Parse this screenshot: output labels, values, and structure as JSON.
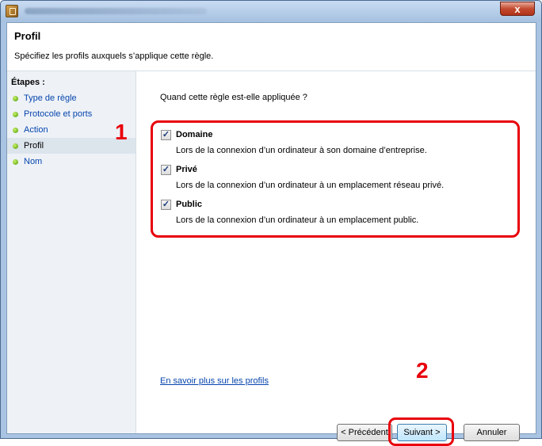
{
  "window": {
    "close_glyph": "x"
  },
  "header": {
    "title": "Profil",
    "description": "Spécifiez les profils auxquels s’applique cette règle."
  },
  "sidebar": {
    "title": "Étapes :",
    "items": [
      {
        "label": "Type de règle"
      },
      {
        "label": "Protocole et ports"
      },
      {
        "label": "Action"
      },
      {
        "label": "Profil"
      },
      {
        "label": "Nom"
      }
    ],
    "current_index": 3
  },
  "main": {
    "question": "Quand cette règle est-elle appliquée ?",
    "options": [
      {
        "title": "Domaine",
        "desc": "Lors de la connexion d’un ordinateur à son domaine d’entreprise.",
        "checked": true
      },
      {
        "title": "Privé",
        "desc": "Lors de la connexion d’un ordinateur à un emplacement réseau privé.",
        "checked": true
      },
      {
        "title": "Public",
        "desc": "Lors de la connexion d’un ordinateur à un emplacement public.",
        "checked": true
      }
    ],
    "learn_more": "En savoir plus sur les profils"
  },
  "buttons": {
    "back": "< Précédent",
    "next": "Suivant >",
    "cancel": "Annuler"
  },
  "annotations": {
    "one": "1",
    "two": "2"
  },
  "colors": {
    "highlight": "#e8000b",
    "link": "#0645ad",
    "step_dot": "#4e9a06"
  }
}
